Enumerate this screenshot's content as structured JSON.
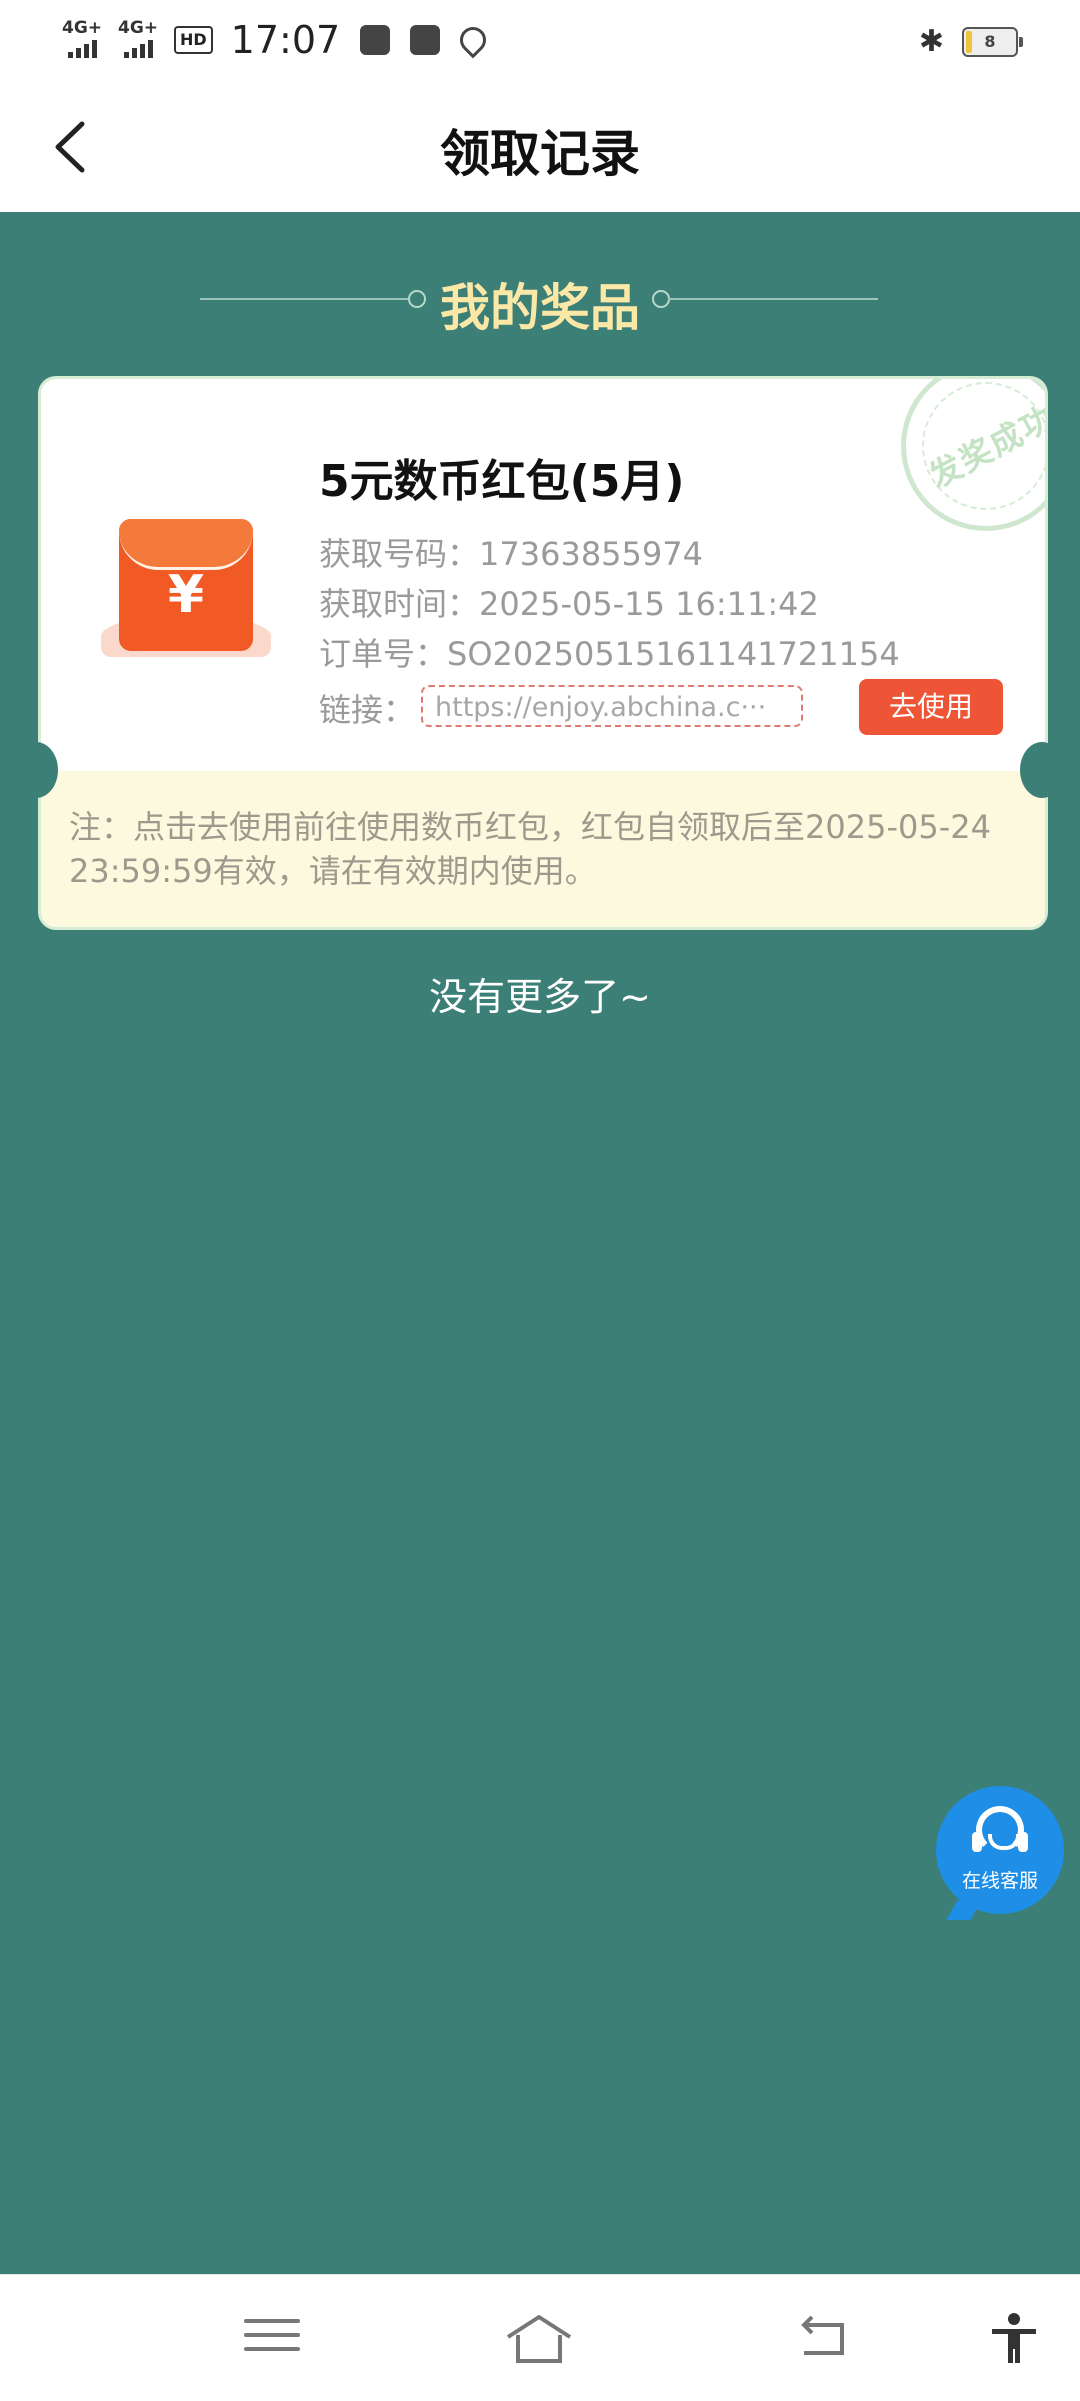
{
  "status_bar": {
    "network1": "4G+",
    "network2": "4G+",
    "hd_badge": "HD",
    "time": "17:07",
    "battery": "8"
  },
  "header": {
    "title": "领取记录"
  },
  "section": {
    "title": "我的奖品"
  },
  "prize": {
    "name": "5元数币红包(5月)",
    "code_label": "获取号码：",
    "code_value": "17363855974",
    "time_label": "获取时间：",
    "time_value": "2025-05-15 16:11:42",
    "order_label": "订单号：",
    "order_value": "SO20250515161141721154",
    "link_label": "链接：",
    "link_value": "https://enjoy.abchina.c···",
    "use_button": "去使用",
    "stamp_text": "发奖成功",
    "note": "注：点击去使用前往使用数币红包，红包自领取后至2025-05-24 23:59:59有效，请在有效期内使用。"
  },
  "list_end": "没有更多了~",
  "service": {
    "label": "在线客服"
  },
  "colors": {
    "background": "#3c7f77",
    "accent_button": "#ed5536",
    "section_title": "#fbe7a6",
    "service_button": "#1f8ee6"
  },
  "icons": [
    "back-arrow-icon",
    "red-envelope-icon",
    "headset-icon",
    "menu-icon",
    "home-icon",
    "back-nav-icon",
    "accessibility-icon"
  ]
}
